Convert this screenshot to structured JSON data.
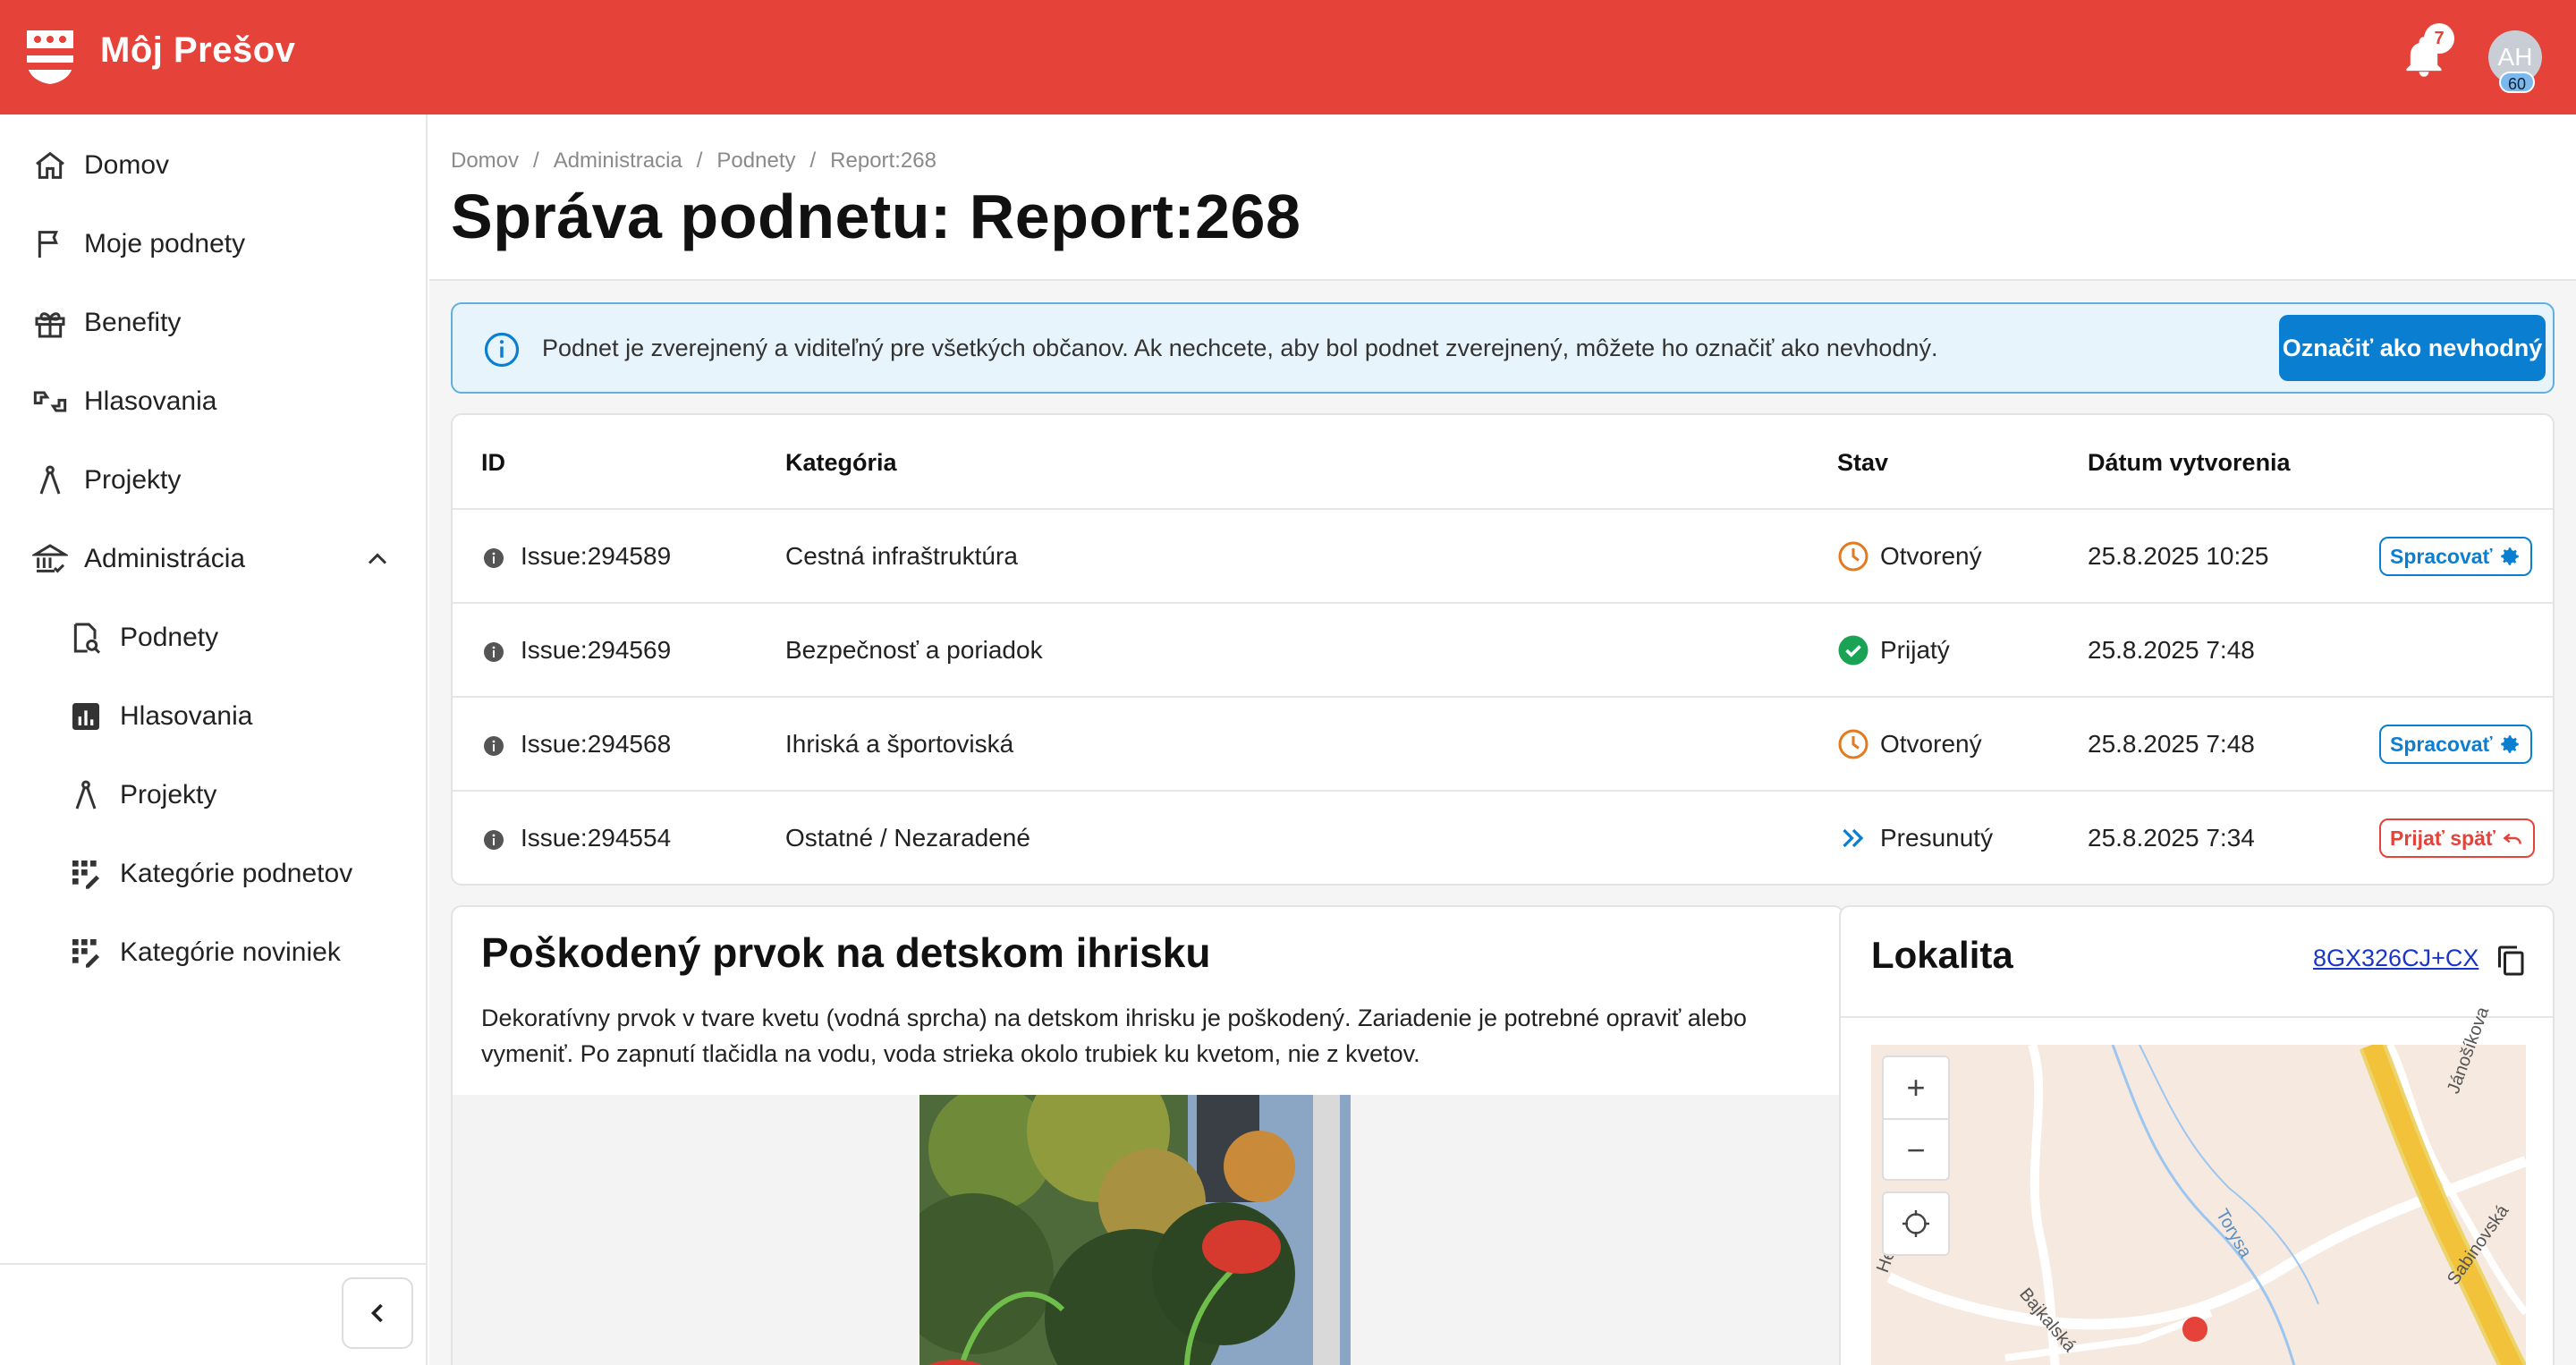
{
  "header": {
    "brand": "Môj Prešov",
    "notification_count": "7",
    "avatar_initials": "AH",
    "avatar_badge": "60"
  },
  "sidebar": {
    "items": [
      {
        "label": "Domov",
        "icon": "home-icon"
      },
      {
        "label": "Moje podnety",
        "icon": "flag-icon"
      },
      {
        "label": "Benefity",
        "icon": "gift-icon"
      },
      {
        "label": "Hlasovania",
        "icon": "vote-icon"
      },
      {
        "label": "Projekty",
        "icon": "compass-icon"
      },
      {
        "label": "Administrácia",
        "icon": "bank-icon"
      }
    ],
    "sub_items": [
      {
        "label": "Podnety",
        "icon": "document-search-icon"
      },
      {
        "label": "Hlasovania",
        "icon": "bar-chart-icon"
      },
      {
        "label": "Projekty",
        "icon": "compass-icon"
      },
      {
        "label": "Kategórie podnetov",
        "icon": "category-edit-icon"
      },
      {
        "label": "Kategórie noviniek",
        "icon": "category-edit-icon"
      }
    ]
  },
  "breadcrumb": [
    "Domov",
    "Administracia",
    "Podnety",
    "Report:268"
  ],
  "page_title": "Správa podnetu: Report:268",
  "alert": {
    "text": "Podnet je zverejnený a viditeľný pre všetkých občanov. Ak nechcete, aby bol podnet zverejnený, môžete ho označiť ako nevhodný.",
    "button": "Označiť ako nevhodný"
  },
  "table": {
    "headers": {
      "id": "ID",
      "category": "Kategória",
      "status": "Stav",
      "created": "Dátum vytvorenia"
    },
    "rows": [
      {
        "id": "Issue:294589",
        "category": "Cestná infraštruktúra",
        "status": "Otvorený",
        "status_icon": "clock-icon",
        "created": "25.8.2025 10:25",
        "action": "Spracovať",
        "action_type": "process"
      },
      {
        "id": "Issue:294569",
        "category": "Bezpečnosť a poriadok",
        "status": "Prijatý",
        "status_icon": "check-circle-icon",
        "created": "25.8.2025 7:48",
        "action": "",
        "action_type": "none"
      },
      {
        "id": "Issue:294568",
        "category": "Ihriská a športoviská",
        "status": "Otvorený",
        "status_icon": "clock-icon",
        "created": "25.8.2025 7:48",
        "action": "Spracovať",
        "action_type": "process"
      },
      {
        "id": "Issue:294554",
        "category": "Ostatné / Nezaradené",
        "status": "Presunutý",
        "status_icon": "double-chevron-right-icon",
        "created": "25.8.2025 7:34",
        "action": "Prijať späť",
        "action_type": "undo"
      }
    ]
  },
  "detail": {
    "title": "Poškodený prvok na detskom ihrisku",
    "description": "Dekoratívny prvok v tvare kvetu (vodná sprcha) na detskom ihrisku je poškodený. Zariadenie je potrebné opraviť alebo vymeniť. Po zapnutí tlačidla na vodu, voda strieka okolo trubiek ku kvetom, nie z kvetov."
  },
  "location": {
    "title": "Lokalita",
    "code": "8GX326CJ+CX",
    "map_zoom_in": "+",
    "map_zoom_out": "−",
    "street_labels": [
      "Jánošíkova",
      "Sabinovská",
      "Torysa",
      "Bajkalská",
      "Herel"
    ]
  },
  "colors": {
    "brand": "#e5423a",
    "primary": "#0a7fd1",
    "open": "#e27a1f",
    "accepted": "#1aa255",
    "moved": "#0a7fd1"
  }
}
